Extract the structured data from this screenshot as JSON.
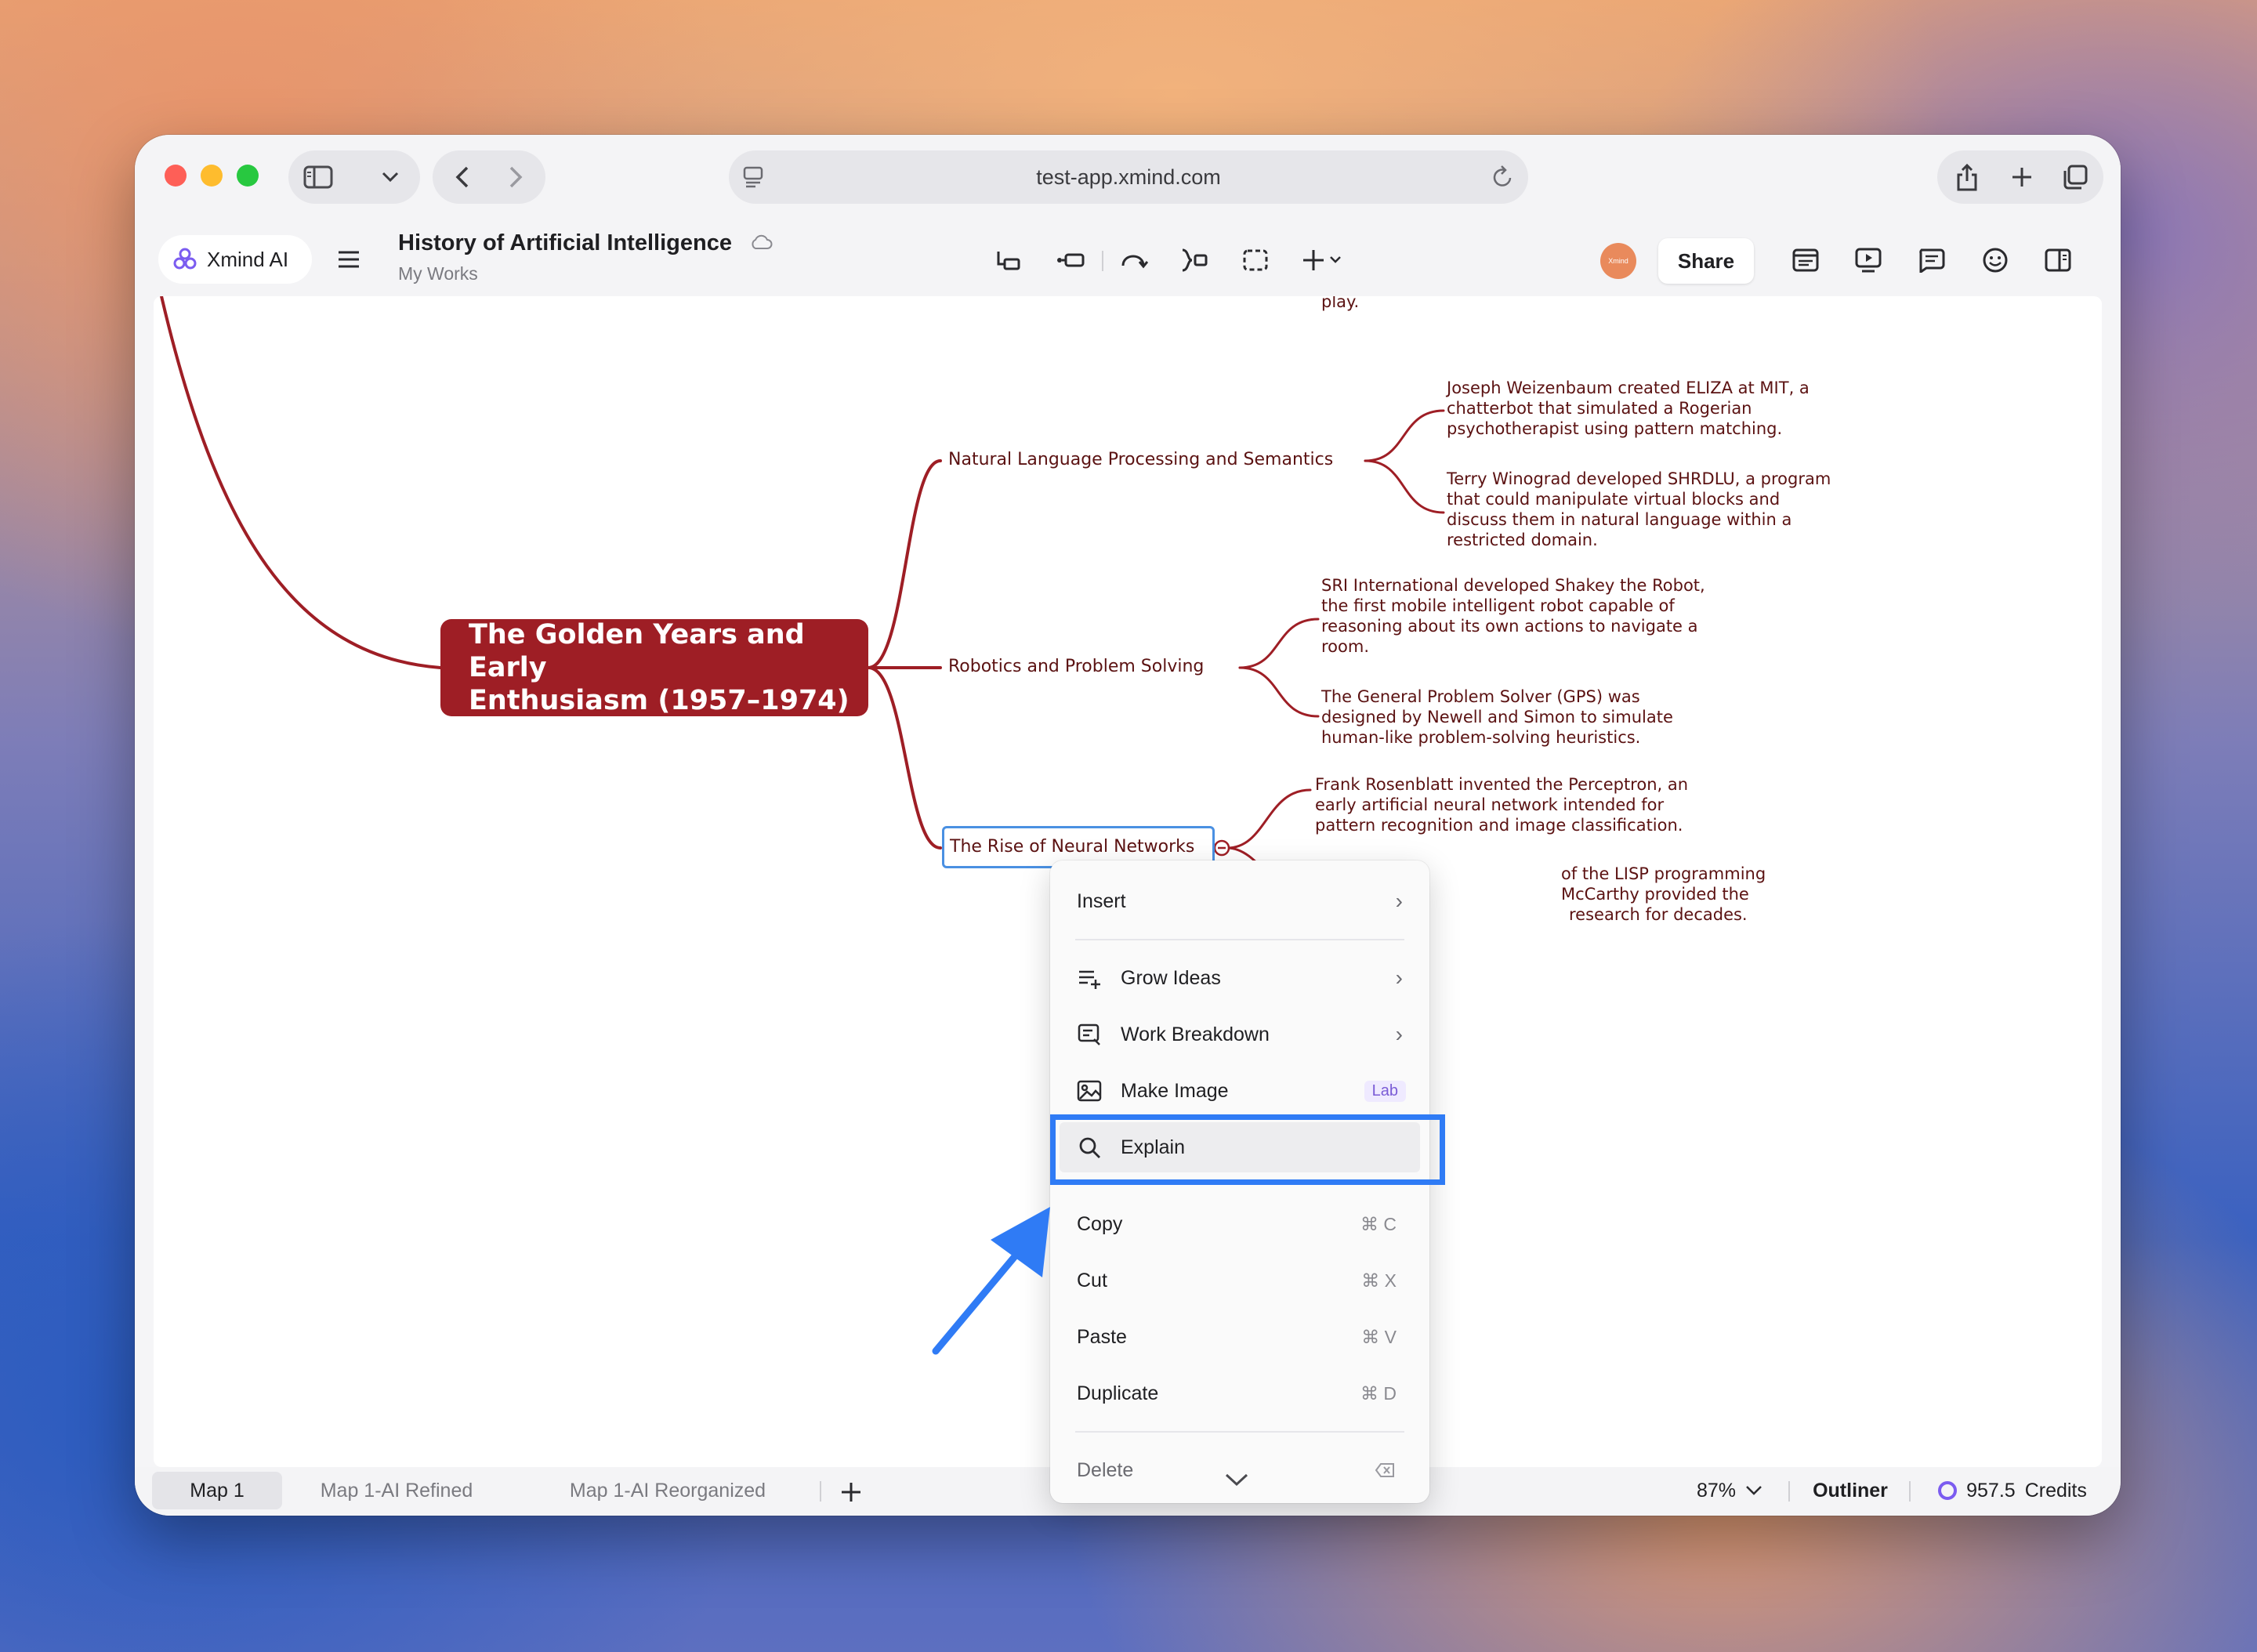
{
  "browser": {
    "url": "test-app.xmind.com"
  },
  "app": {
    "brand_label": "Xmind AI",
    "doc_title": "History of Artificial Intelligence",
    "doc_subtitle": "My Works",
    "avatar_text": "Xmind",
    "share_label": "Share"
  },
  "mindmap": {
    "top_fragment": "play.",
    "central_topic_line1": "The Golden Years and Early",
    "central_topic_line2": "Enthusiasm (1957–1974)",
    "branches": [
      {
        "label": "Natural Language Processing and Semantics",
        "details": [
          [
            "Joseph Weizenbaum created ELIZA at MIT, a",
            "chatterbot that simulated a Rogerian",
            "psychotherapist using pattern matching."
          ],
          [
            "Terry Winograd developed SHRDLU, a program",
            "that could manipulate virtual blocks and",
            "discuss them in natural language within a",
            "restricted domain."
          ]
        ]
      },
      {
        "label": "Robotics and Problem Solving",
        "details": [
          [
            "SRI International developed Shakey the Robot,",
            "the first mobile intelligent robot capable of",
            "reasoning about its own actions to navigate a",
            "room."
          ],
          [
            "The General Problem Solver (GPS) was",
            "designed by Newell and Simon to simulate",
            "human-like problem-solving heuristics."
          ]
        ]
      },
      {
        "label": "The Rise of Neural Networks",
        "details": [
          [
            "Frank Rosenblatt invented the Perceptron, an",
            "early artificial neural network intended for",
            "pattern recognition and image classification."
          ],
          [
            "of the LISP programming",
            "McCarthy provided the",
            "research for decades."
          ]
        ]
      }
    ]
  },
  "context_menu": {
    "insert": "Insert",
    "grow_ideas": "Grow Ideas",
    "work_breakdown": "Work Breakdown",
    "make_image": "Make Image",
    "lab_badge": "Lab",
    "explain": "Explain",
    "copy": "Copy",
    "copy_kbd": "⌘ C",
    "cut": "Cut",
    "cut_kbd": "⌘ X",
    "paste": "Paste",
    "paste_kbd": "⌘ V",
    "duplicate": "Duplicate",
    "duplicate_kbd": "⌘ D",
    "delete": "Delete"
  },
  "bottom": {
    "tabs": [
      "Map 1",
      "Map 1-AI Refined",
      "Map 1-AI Reorganized"
    ],
    "zoom": "87%",
    "outliner": "Outliner",
    "credits_value": "957.5",
    "credits_label": "Credits"
  },
  "colors": {
    "central_topic": "#9e1e25",
    "branch_line": "#9e1e25",
    "highlight": "#2f7bf5"
  }
}
